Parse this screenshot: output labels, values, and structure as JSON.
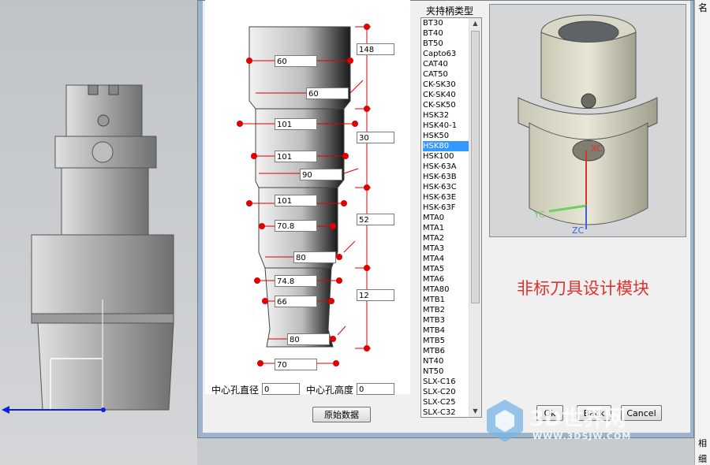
{
  "dialog": {
    "holder_list_title": "夹持柄类型",
    "holder_types": [
      "BT30",
      "BT40",
      "BT50",
      "Capto63",
      "CAT40",
      "CAT50",
      "CK-SK30",
      "CK-SK40",
      "CK-SK50",
      "HSK32",
      "HSK40-1",
      "HSK50",
      "HSK80",
      "HSK100",
      "HSK-63A",
      "HSK-63B",
      "HSK-63C",
      "HSK-63E",
      "HSK-63F",
      "MTA0",
      "MTA1",
      "MTA2",
      "MTA3",
      "MTA4",
      "MTA5",
      "MTA6",
      "MTA80",
      "MTB1",
      "MTB2",
      "MTB3",
      "MTB4",
      "MTB5",
      "MTB6",
      "NT40",
      "NT50",
      "SLX-C16",
      "SLX-C20",
      "SLX-C25",
      "SLX-C32"
    ],
    "selected_holder": "HSK80",
    "dimensions": {
      "d1": "60",
      "d2": "60",
      "d3": "101",
      "d4": "101",
      "d5": "90",
      "d6": "101",
      "d7": "70.8",
      "d8": "80",
      "d9": "74.8",
      "d10": "66",
      "d11": "80",
      "d12": "70",
      "len1": "148",
      "len2": "30",
      "len3": "52",
      "len4": "12"
    },
    "center_hole_diameter_label": "中心孔直径",
    "center_hole_diameter_value": "0",
    "center_hole_height_label": "中心孔高度",
    "center_hole_height_value": "0",
    "original_data_button": "原始数据",
    "ok_button": "Ok",
    "back_button": "Back",
    "cancel_button": "Cancel",
    "module_title": "非标刀具设计模块",
    "preview_axis_labels": {
      "x": "XC",
      "y": "YC",
      "z": "ZC"
    }
  },
  "right_panel": {
    "header": "名",
    "items": [
      "相",
      "细"
    ]
  },
  "watermark": {
    "text": "3D世界网",
    "url": "WWW.3DSJW.COM"
  },
  "colors": {
    "dimension_red": "#e00000",
    "selection_blue": "#3399ff",
    "module_title_red": "#e0322d"
  }
}
